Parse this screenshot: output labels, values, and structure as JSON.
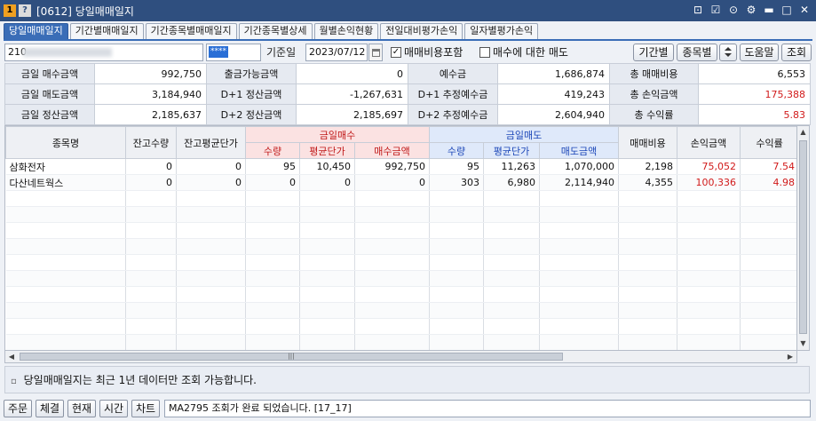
{
  "window": {
    "badge_one": "1",
    "badge_help": "?",
    "title": "[0612] 당일매매일지",
    "controls": [
      "⊡",
      "☑",
      "⊙",
      "⚙",
      "▬",
      "□",
      "✕"
    ]
  },
  "tabs": [
    {
      "label": "당일매매일지",
      "active": true
    },
    {
      "label": "기간별매매일지",
      "active": false
    },
    {
      "label": "기간종목별매매일지",
      "active": false
    },
    {
      "label": "기간종목별상세",
      "active": false
    },
    {
      "label": "월별손익현황",
      "active": false
    },
    {
      "label": "전일대비평가손익",
      "active": false
    },
    {
      "label": "일자별평가손익",
      "active": false
    }
  ],
  "query": {
    "account_prefix": "210-",
    "password_mask": "****",
    "date_label": "기준일",
    "date_value": "2023/07/12",
    "include_fee_label": "매매비용포함",
    "include_fee_checked": true,
    "buy_sell_label": "매수에 대한 매도",
    "buy_sell_checked": false,
    "btn_period": "기간별",
    "btn_item": "종목별",
    "btn_help": "도움말",
    "btn_query": "조회"
  },
  "summary": [
    [
      {
        "label": "금일 매수금액",
        "value": "992,750"
      },
      {
        "label": "출금가능금액",
        "value": "0"
      },
      {
        "label": "예수금",
        "value": "1,686,874"
      },
      {
        "label": "총 매매비용",
        "value": "6,553",
        "red": false
      }
    ],
    [
      {
        "label": "금일 매도금액",
        "value": "3,184,940"
      },
      {
        "label": "D+1 정산금액",
        "value": "-1,267,631"
      },
      {
        "label": "D+1 추정예수금",
        "value": "419,243"
      },
      {
        "label": "총 손익금액",
        "value": "175,388",
        "red": true
      }
    ],
    [
      {
        "label": "금일 정산금액",
        "value": "2,185,637"
      },
      {
        "label": "D+2 정산금액",
        "value": "2,185,697"
      },
      {
        "label": "D+2 추정예수금",
        "value": "2,604,940"
      },
      {
        "label": "총 수익률",
        "value": "5.83",
        "red": true
      }
    ]
  ],
  "grid": {
    "headers": {
      "name": "종목명",
      "hold_qty": "잔고수량",
      "hold_avg": "잔고평균단가",
      "buy_group": "금일매수",
      "sell_group": "금일매도",
      "qty": "수량",
      "avg": "평균단가",
      "buy_amt": "매수금액",
      "sell_amt": "매도금액",
      "fee": "매매비용",
      "pnl": "손익금액",
      "rate": "수익률"
    },
    "rows": [
      {
        "name": "삼화전자",
        "hold_qty": "0",
        "hold_avg": "0",
        "buy_qty": "95",
        "buy_avg": "10,450",
        "buy_amt": "992,750",
        "sell_qty": "95",
        "sell_avg": "11,263",
        "sell_amt": "1,070,000",
        "fee": "2,198",
        "pnl": "75,052",
        "rate": "7.54"
      },
      {
        "name": "다산네트웍스",
        "hold_qty": "0",
        "hold_avg": "0",
        "buy_qty": "0",
        "buy_avg": "0",
        "buy_amt": "0",
        "sell_qty": "303",
        "sell_avg": "6,980",
        "sell_amt": "2,114,940",
        "fee": "4,355",
        "pnl": "100,336",
        "rate": "4.98"
      }
    ]
  },
  "notice": {
    "marker": "▫",
    "text": "당일매매일지는 최근 1년 데이터만 조회 가능합니다."
  },
  "status": {
    "buttons": [
      "주문",
      "체결",
      "현재",
      "시간",
      "차트"
    ],
    "message": "MA2795 조회가 완료 되었습니다. [17_17]"
  }
}
